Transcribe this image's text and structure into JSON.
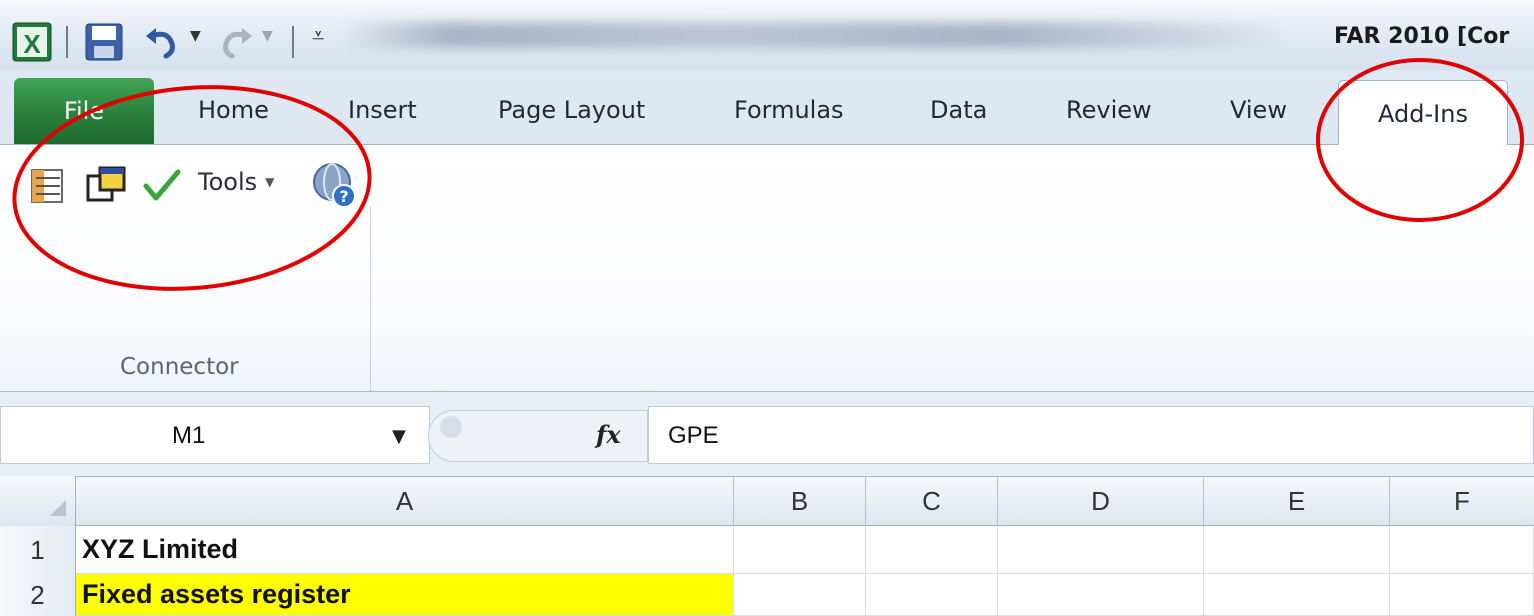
{
  "window": {
    "title": "FAR 2010 [Cor"
  },
  "tabs": [
    {
      "label": "File"
    },
    {
      "label": "Home"
    },
    {
      "label": "Insert"
    },
    {
      "label": "Page Layout"
    },
    {
      "label": "Formulas"
    },
    {
      "label": "Data"
    },
    {
      "label": "Review"
    },
    {
      "label": "View"
    },
    {
      "label": "Add-Ins"
    }
  ],
  "ribbon": {
    "group_label": "Connector",
    "tools_label": "Tools",
    "icons": [
      "sheet-icon",
      "windows-icon",
      "checkmark-icon",
      "help-globe-icon"
    ]
  },
  "formula_bar": {
    "name_box": "M1",
    "fx_label": "fx",
    "value": "GPE"
  },
  "grid": {
    "columns": [
      "A",
      "B",
      "C",
      "D",
      "E",
      "F"
    ],
    "rows": [
      {
        "num": "1",
        "a": "XYZ Limited"
      },
      {
        "num": "2",
        "a": "Fixed assets register"
      }
    ]
  },
  "colors": {
    "file_tab": "#2a7f3a",
    "highlight": "#ffff00",
    "annotation": "#e00000"
  }
}
